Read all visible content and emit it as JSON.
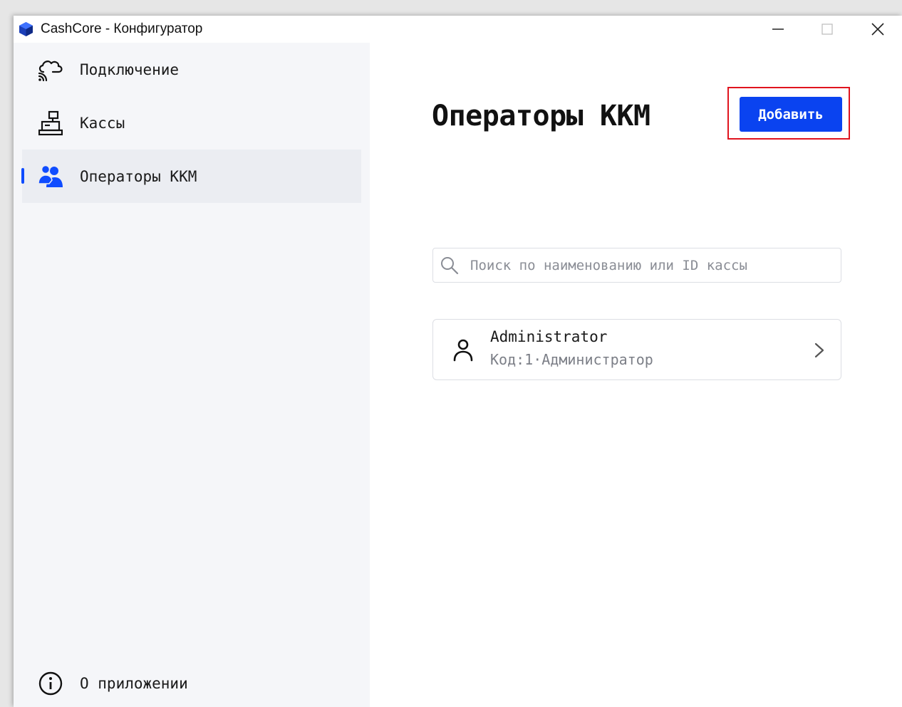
{
  "window": {
    "title": "CashCore - Конфигуратор",
    "logo_icon": "cashcore-logo-icon"
  },
  "sidebar": {
    "items": [
      {
        "label": "Подключение",
        "icon": "cloud-connection-icon",
        "active": false
      },
      {
        "label": "Кассы",
        "icon": "cash-register-icon",
        "active": false
      },
      {
        "label": "Операторы ККМ",
        "icon": "users-icon",
        "active": true
      }
    ],
    "about": {
      "label": "О приложении",
      "icon": "info-icon"
    }
  },
  "main": {
    "title": "Операторы ККМ",
    "add_button_label": "Добавить",
    "search": {
      "placeholder": "Поиск по наименованию или ID кассы",
      "value": ""
    },
    "operators": [
      {
        "name": "Administrator",
        "subtitle": "Код:1·Администратор"
      }
    ]
  },
  "colors": {
    "accent": "#0a43f0",
    "highlight": "#e0141e",
    "sidebar_bg": "#f5f6f9",
    "active_item_bg": "#ebedf2"
  }
}
